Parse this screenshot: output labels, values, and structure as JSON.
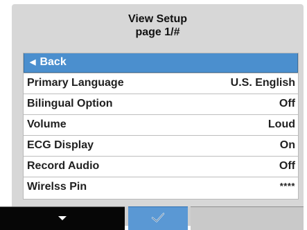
{
  "header": {
    "title": "View Setup",
    "page": "page 1/#"
  },
  "list": {
    "items": [
      {
        "label": "Back",
        "value": "",
        "selected": true,
        "icon": "back-arrow-icon"
      },
      {
        "label": "Primary Language",
        "value": "U.S. English"
      },
      {
        "label": "Bilingual Option",
        "value": "Off"
      },
      {
        "label": "Volume",
        "value": "Loud"
      },
      {
        "label": "ECG Display",
        "value": "On"
      },
      {
        "label": "Record Audio",
        "value": "Off"
      },
      {
        "label": "Wirelss Pin",
        "value": "****"
      }
    ]
  },
  "softkeys": [
    {
      "name": "down",
      "icon": "down-arrow-icon"
    },
    {
      "name": "confirm",
      "icon": "check-icon"
    },
    {
      "name": "blank",
      "icon": ""
    }
  ],
  "colors": {
    "screen_bg": "#d7d7d7",
    "selection": "#4b8fce",
    "confirm_key": "#5a98d4"
  }
}
